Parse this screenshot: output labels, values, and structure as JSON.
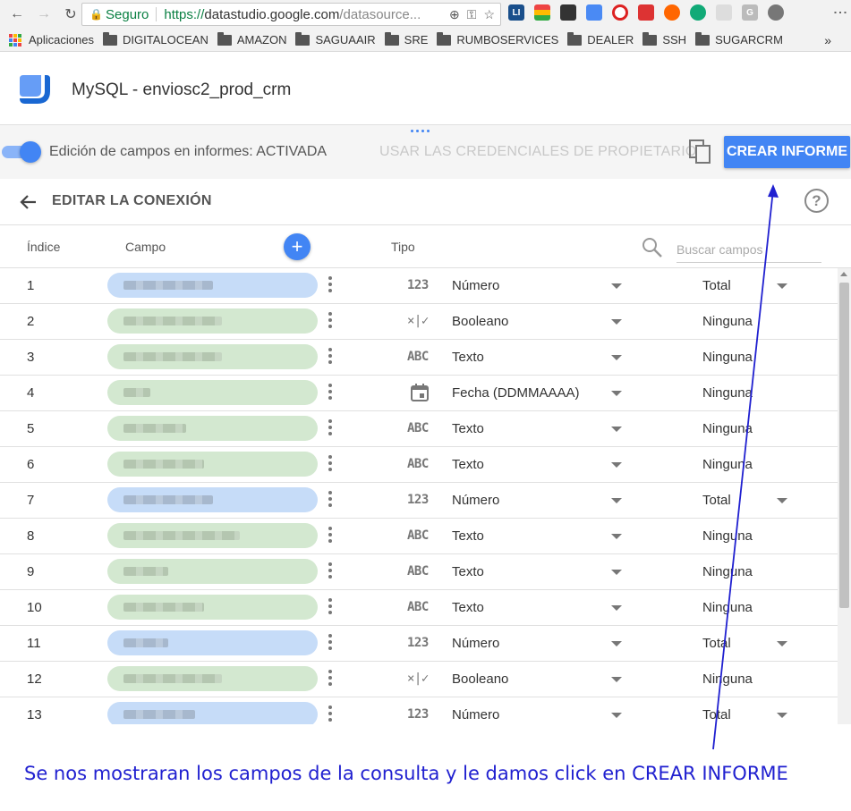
{
  "browser": {
    "secure_label": "Seguro",
    "url_protocol": "https://",
    "url_host": "datastudio.google.com",
    "url_path": "/datasource...",
    "extension_labels": [
      "LI",
      "G"
    ]
  },
  "bookmarks": {
    "apps_label": "Aplicaciones",
    "items": [
      "DIGITALOCEAN",
      "AMAZON",
      "SAGUAAIR",
      "SRE",
      "RUMBOSERVICES",
      "DEALER",
      "SSH",
      "SUGARCRM"
    ],
    "more_label": "»"
  },
  "header": {
    "title": "MySQL - enviosc2_prod_crm"
  },
  "toolbar": {
    "toggle_label": "Edición de campos en informes: ACTIVADA",
    "owner_credentials_label": "USAR LAS CREDENCIALES DE PROPIETARIO",
    "create_report_label": "CREAR INFORME"
  },
  "edit": {
    "title": "EDITAR LA CONEXIÓN",
    "help_label": "?"
  },
  "table": {
    "headers": {
      "index": "Índice",
      "field": "Campo",
      "type": "Tipo",
      "add_label": "+"
    },
    "search": {
      "placeholder": "Buscar campos"
    },
    "rows": [
      {
        "index": "1",
        "color": "blue",
        "type_icon": "123",
        "type": "Número",
        "aggregation": "Total"
      },
      {
        "index": "2",
        "color": "green",
        "type_icon": "×|✓",
        "type": "Booleano",
        "aggregation": "Ninguna"
      },
      {
        "index": "3",
        "color": "green",
        "type_icon": "ABC",
        "type": "Texto",
        "aggregation": "Ninguna"
      },
      {
        "index": "4",
        "color": "green",
        "type_icon": "calendar",
        "type": "Fecha (DDMMAAAA)",
        "aggregation": "Ninguna"
      },
      {
        "index": "5",
        "color": "green",
        "type_icon": "ABC",
        "type": "Texto",
        "aggregation": "Ninguna"
      },
      {
        "index": "6",
        "color": "green",
        "type_icon": "ABC",
        "type": "Texto",
        "aggregation": "Ninguna"
      },
      {
        "index": "7",
        "color": "blue",
        "type_icon": "123",
        "type": "Número",
        "aggregation": "Total"
      },
      {
        "index": "8",
        "color": "green",
        "type_icon": "ABC",
        "type": "Texto",
        "aggregation": "Ninguna"
      },
      {
        "index": "9",
        "color": "green",
        "type_icon": "ABC",
        "type": "Texto",
        "aggregation": "Ninguna"
      },
      {
        "index": "10",
        "color": "green",
        "type_icon": "ABC",
        "type": "Texto",
        "aggregation": "Ninguna"
      },
      {
        "index": "11",
        "color": "blue",
        "type_icon": "123",
        "type": "Número",
        "aggregation": "Total"
      },
      {
        "index": "12",
        "color": "green",
        "type_icon": "×|✓",
        "type": "Booleano",
        "aggregation": "Ninguna"
      },
      {
        "index": "13",
        "color": "blue",
        "type_icon": "123",
        "type": "Número",
        "aggregation": "Total"
      }
    ]
  },
  "annotation": {
    "text": "Se nos mostraran los campos de la consulta y le damos click en CREAR INFORME"
  },
  "colors": {
    "accent": "#4285f4",
    "annotation": "#2020d0",
    "metric_chip": "#c6dcf8",
    "dimension_chip": "#d3e8d0"
  }
}
